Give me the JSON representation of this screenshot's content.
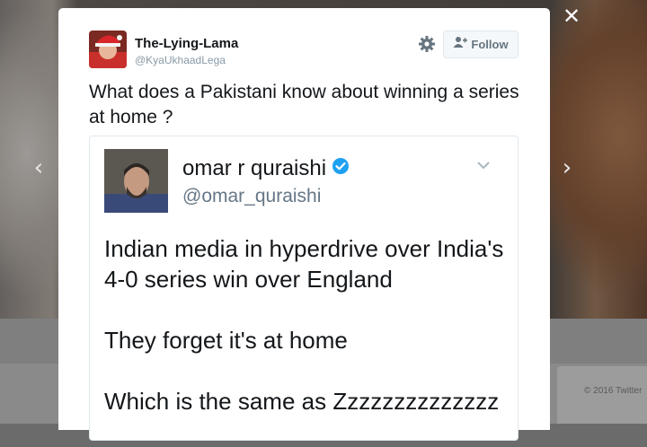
{
  "colors": {
    "verified": "#1da1f2",
    "text": "#14171a",
    "muted": "#8899a6"
  },
  "modal": {
    "close_icon": "close-icon",
    "tweet": {
      "author": {
        "display_name": "The-Lying-Lama",
        "handle": "@KyaUkhaadLega"
      },
      "follow_label": "Follow",
      "text": "What does a Pakistani know about winning a series at home ?"
    },
    "quoted_tweet": {
      "author": {
        "display_name": "omar r quraishi",
        "handle": "@omar_quraishi",
        "verified": true
      },
      "paragraphs": [
        "Indian media in hyperdrive over India's 4-0 series win over England",
        "They forget it's at home",
        "Which is the same as Zzzzzzzzzzzzzz"
      ]
    }
  },
  "footer": {
    "copyright": "© 2016 Twitter"
  }
}
